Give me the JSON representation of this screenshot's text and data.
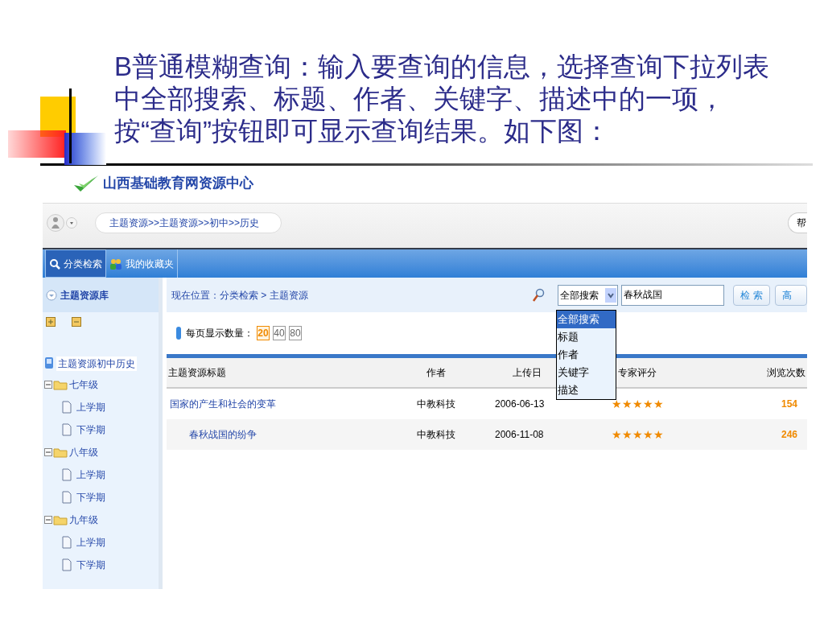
{
  "slide": {
    "text": "B普通模糊查询：输入要查询的信息，选择查询下拉列表中全部搜索、标题、作者、关键字、描述中的一项，按“查询”按钮即可显示查询结果。如下图："
  },
  "app": {
    "logo": "山西基础教育网资源中心",
    "breadcrumb": "主题资源>>主题资源>>初中>>历史",
    "help_button": "帮",
    "tabs": [
      {
        "label": "分类检索",
        "selected": true
      },
      {
        "label": "我的收藏夹",
        "selected": false
      }
    ],
    "sidebar": {
      "title": "主题资源库",
      "root": "主题资源初中历史",
      "tree": [
        {
          "label": "七年级",
          "expanded": true,
          "children": [
            {
              "label": "上学期"
            },
            {
              "label": "下学期"
            }
          ]
        },
        {
          "label": "八年级",
          "expanded": true,
          "children": [
            {
              "label": "上学期"
            },
            {
              "label": "下学期"
            }
          ]
        },
        {
          "label": "九年级",
          "expanded": true,
          "children": [
            {
              "label": "上学期"
            },
            {
              "label": "下学期"
            }
          ]
        }
      ]
    },
    "location": "现在位置：分类检索 > 主题资源",
    "search": {
      "scope": "全部搜索",
      "value": "春秋战国",
      "buttons": [
        "检 索",
        "高"
      ],
      "options": [
        {
          "label": "全部搜索",
          "selected": true
        },
        {
          "label": "标题",
          "selected": false
        },
        {
          "label": "作者",
          "selected": false
        },
        {
          "label": "关键字",
          "selected": false
        },
        {
          "label": "描述",
          "selected": false
        }
      ]
    },
    "page_size": {
      "label": "每页显示数量：",
      "options": [
        {
          "label": "20",
          "selected": true
        },
        {
          "label": "40",
          "selected": false
        },
        {
          "label": "80",
          "selected": false
        }
      ]
    },
    "table": {
      "columns": [
        "主题资源标题",
        "作者",
        "上传日",
        "专家评分",
        "浏览次数"
      ],
      "rows": [
        {
          "title": "国家的产生和社会的变革",
          "author": "中教科技",
          "date": "2006-06-13",
          "stars": 5,
          "views": "154",
          "children": [
            {
              "title": "春秋战国的纷争",
              "author": "中教科技",
              "date": "2006-11-08",
              "stars": 5,
              "views": "246"
            }
          ]
        }
      ]
    }
  }
}
